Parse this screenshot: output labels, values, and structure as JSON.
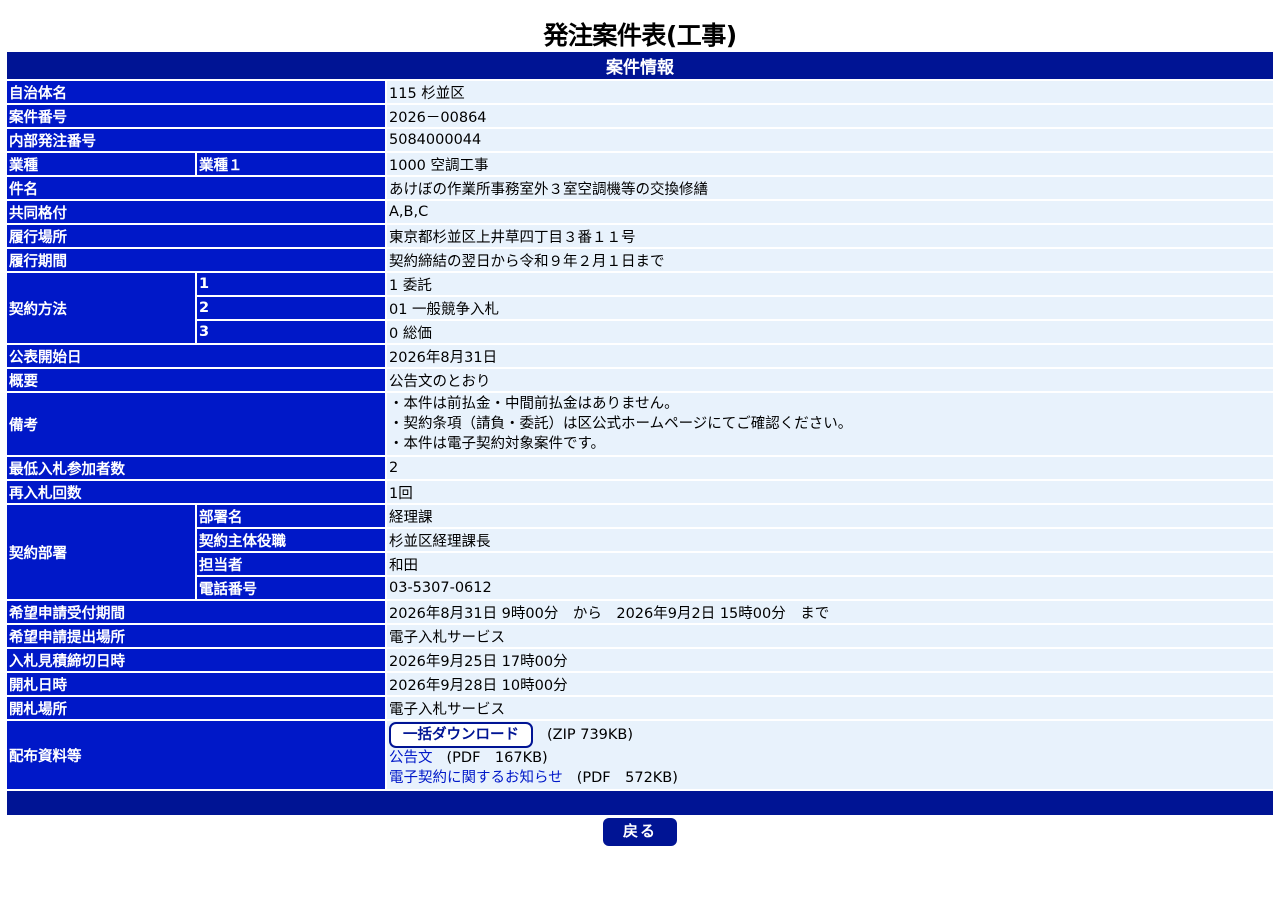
{
  "page_title": "発注案件表(工事)",
  "section_title": "案件情報",
  "rows": {
    "municipality": {
      "label": "自治体名",
      "value": "115 杉並区"
    },
    "case_number": {
      "label": "案件番号",
      "value": "2026－00864"
    },
    "internal_number": {
      "label": "内部発注番号",
      "value": "5084000044"
    },
    "industry": {
      "label": "業種",
      "sublabel": "業種１",
      "value": "1000 空調工事"
    },
    "subject": {
      "label": "件名",
      "value": "あけぼの作業所事務室外３室空調機等の交換修繕"
    },
    "jv_rating": {
      "label": "共同格付",
      "value": "A,B,C"
    },
    "location": {
      "label": "履行場所",
      "value": "東京都杉並区上井草四丁目３番１１号"
    },
    "period": {
      "label": "履行期間",
      "value": "契約締結の翌日から令和９年２月１日まで"
    },
    "contract_method": {
      "label": "契約方法",
      "items": [
        {
          "sublabel": "1",
          "value": "1 委託"
        },
        {
          "sublabel": "2",
          "value": "01 一般競争入札"
        },
        {
          "sublabel": "3",
          "value": "0 総価"
        }
      ]
    },
    "publish_date": {
      "label": "公表開始日",
      "value": "2026年8月31日"
    },
    "overview": {
      "label": "概要",
      "value": "公告文のとおり"
    },
    "remarks": {
      "label": "備考",
      "lines": [
        "・本件は前払金・中間前払金はありません。",
        "・契約条項（請負・委託）は区公式ホームページにてご確認ください。",
        "・本件は電子契約対象案件です。"
      ]
    },
    "min_bidders": {
      "label": "最低入札参加者数",
      "value": "2"
    },
    "rebid_count": {
      "label": "再入札回数",
      "value": "1回"
    },
    "department": {
      "label": "契約部署",
      "items": [
        {
          "sublabel": "部署名",
          "value": "経理課"
        },
        {
          "sublabel": "契約主体役職",
          "value": "杉並区経理課長"
        },
        {
          "sublabel": "担当者",
          "value": "和田"
        },
        {
          "sublabel": "電話番号",
          "value": "03-5307-0612"
        }
      ]
    },
    "application_period": {
      "label": "希望申請受付期間",
      "value": "2026年8月31日 9時00分　から　2026年9月2日 15時00分　まで"
    },
    "application_place": {
      "label": "希望申請提出場所",
      "value": "電子入札サービス"
    },
    "bid_deadline": {
      "label": "入札見積締切日時",
      "value": "2026年9月25日 17時00分"
    },
    "opening_date": {
      "label": "開札日時",
      "value": "2026年9月28日 10時00分"
    },
    "opening_place": {
      "label": "開札場所",
      "value": "電子入札サービス"
    },
    "documents": {
      "label": "配布資料等",
      "bulk_download_label": "一括ダウンロード",
      "bulk_download_note": "(ZIP 739KB)",
      "files": [
        {
          "name": "公告文",
          "note": "(PDF　167KB)"
        },
        {
          "name": "電子契約に関するお知らせ",
          "note": "(PDF　572KB)"
        }
      ]
    }
  },
  "back_button_label": "戻る"
}
